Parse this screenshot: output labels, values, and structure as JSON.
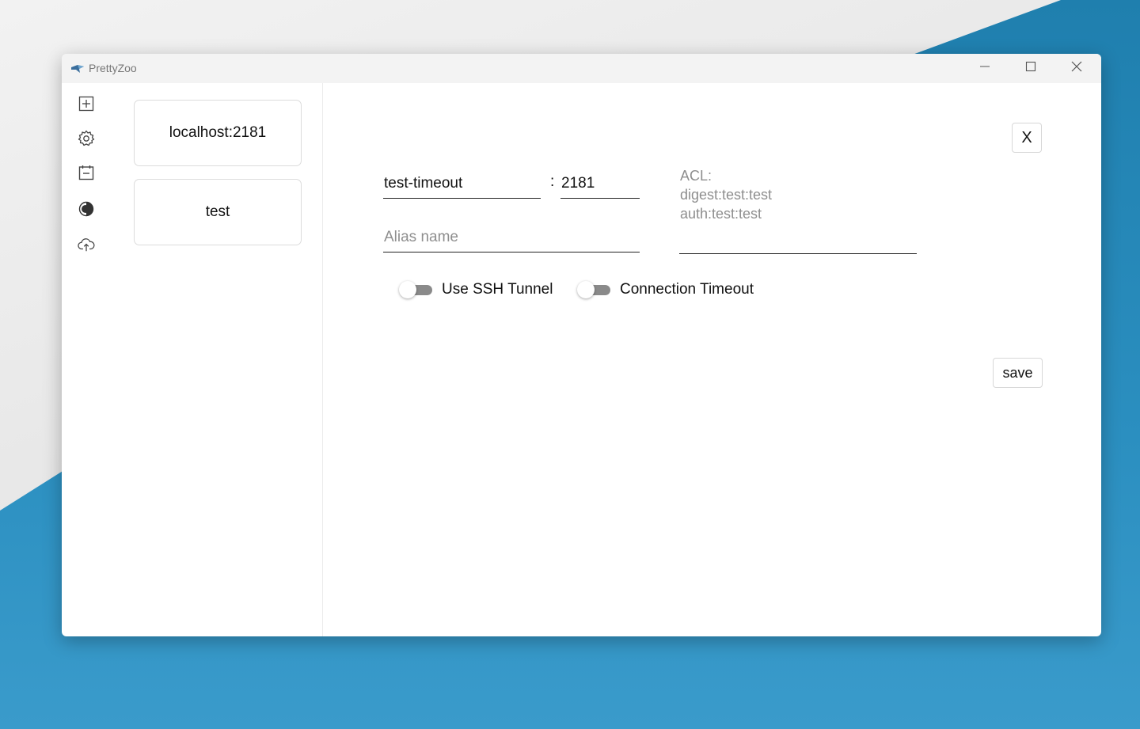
{
  "window": {
    "title": "PrettyZoo",
    "controls": {
      "minimize": "minimize-icon",
      "maximize": "maximize-icon",
      "close": "close-icon"
    }
  },
  "sidebar": {
    "icons": [
      "add-server-icon",
      "settings-icon",
      "log-icon",
      "theme-icon",
      "upload-icon"
    ]
  },
  "servers": [
    {
      "label": "localhost:2181"
    },
    {
      "label": "test"
    }
  ],
  "form": {
    "close_label": "X",
    "host": {
      "value": "test-timeout"
    },
    "port_separator": ":",
    "port": {
      "value": "2181"
    },
    "alias": {
      "value": "",
      "placeholder": "Alias name"
    },
    "acl": {
      "placeholder": "ACL:\ndigest:test:test\nauth:test:test"
    },
    "ssh_toggle": {
      "label": "Use SSH Tunnel",
      "on": false
    },
    "timeout_toggle": {
      "label": "Connection Timeout",
      "on": false
    },
    "save_label": "save"
  },
  "colors": {
    "accent": "#2b8fc0",
    "toggle_off": "#8a8a8a",
    "placeholder": "#8e8e8e"
  }
}
